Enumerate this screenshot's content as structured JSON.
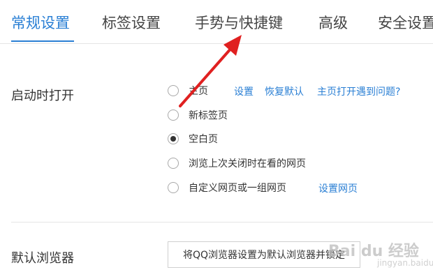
{
  "tabs": [
    {
      "label": "常规设置"
    },
    {
      "label": "标签设置"
    },
    {
      "label": "手势与快捷键"
    },
    {
      "label": "高级"
    },
    {
      "label": "安全设置"
    }
  ],
  "accent_color": "#2a7fd4",
  "startup": {
    "label": "启动时打开",
    "options": [
      {
        "label": "主页",
        "checked": false
      },
      {
        "label": "新标签页",
        "checked": false
      },
      {
        "label": "空白页",
        "checked": true
      },
      {
        "label": "浏览上次关闭时在看的网页",
        "checked": false
      },
      {
        "label": "自定义网页或一组网页",
        "checked": false
      }
    ],
    "homepage_links": {
      "settings": "设置",
      "restore_default": "恢复默认",
      "problem": "主页打开遇到问题?"
    },
    "custom_link": "设置网页"
  },
  "default_browser": {
    "label": "默认浏览器",
    "button_label": "将QQ浏览器设置为默认浏览器并锁定"
  },
  "watermark": {
    "text": "Bai du 经验",
    "sub": "jingyan.baidu.com"
  },
  "annotation": {
    "arrow_color": "#e02020"
  }
}
